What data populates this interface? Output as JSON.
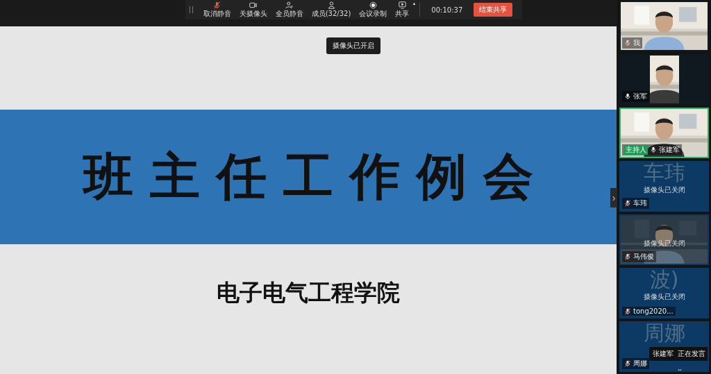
{
  "toolbar": {
    "buttons": [
      {
        "kind": "mic-off",
        "label": "取消静音"
      },
      {
        "kind": "camera",
        "label": "关摄像头"
      },
      {
        "kind": "mute-all",
        "label": "全员静音"
      },
      {
        "kind": "members",
        "label": "成员(32/32)"
      },
      {
        "kind": "record",
        "label": "会议录制"
      },
      {
        "kind": "share",
        "label": "共享",
        "caret": "▴"
      }
    ],
    "timer": "00:10:37",
    "end_button": "结束共享"
  },
  "slide": {
    "toast": "摄像头已开启",
    "title": "班主任工作例会",
    "subtitle": "电子电气工程学院"
  },
  "participants": [
    {
      "name": "我",
      "kind": "video",
      "muted": true,
      "selected": false
    },
    {
      "name": "张军",
      "kind": "video",
      "muted": false,
      "selected": false
    },
    {
      "name": "张建军",
      "kind": "video",
      "muted": false,
      "host_label": "主持人",
      "selected": true
    },
    {
      "name": "车玮",
      "kind": "camera_off",
      "big_text": "车玮",
      "overlay": "摄像头已关闭",
      "muted": true,
      "selected": false
    },
    {
      "name": "马伟俊",
      "kind": "video_off",
      "overlay": "摄像头已关闭",
      "muted": true,
      "selected": false
    },
    {
      "name": "tong2020...",
      "kind": "camera_off",
      "big_text": "波)",
      "overlay": "摄像头已关闭",
      "muted": true,
      "selected": false
    },
    {
      "name": "周娜",
      "kind": "camera_off",
      "big_text": "周娜",
      "muted": true,
      "selected": false
    }
  ],
  "speaking_toast": {
    "name": "张建军",
    "status": "正在发言"
  },
  "panel_toggle": "›",
  "scroll_down": "⌄"
}
